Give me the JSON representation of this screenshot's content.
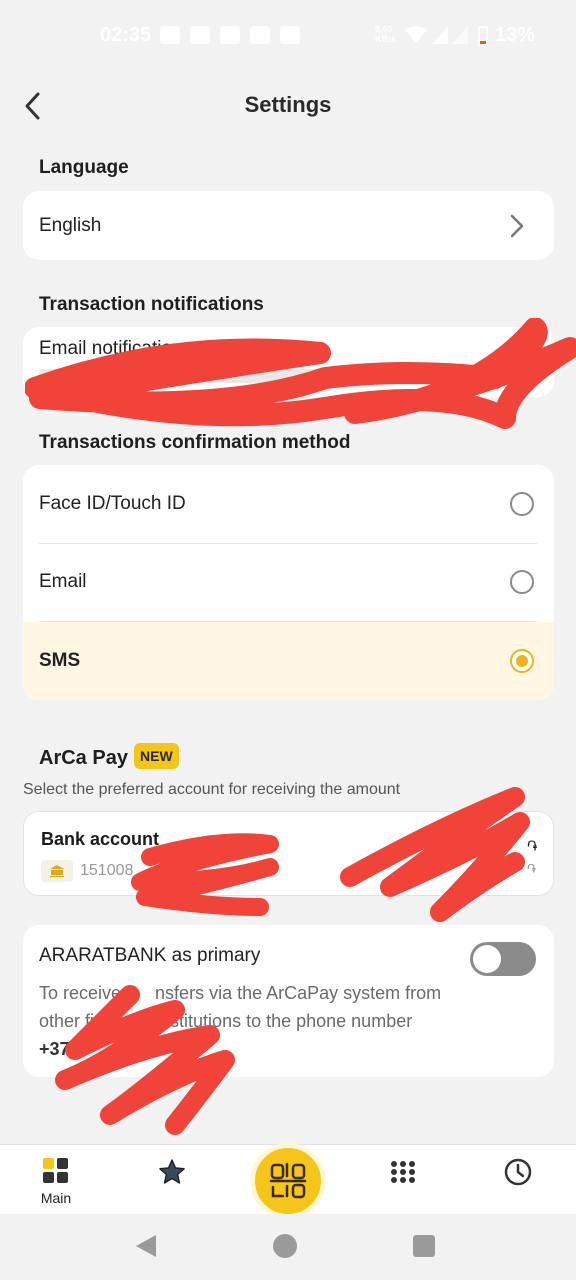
{
  "status_bar": {
    "time": "02:35",
    "battery": "13%",
    "speed": "0.60 KB/s"
  },
  "header": {
    "title": "Settings"
  },
  "language": {
    "section_title": "Language",
    "value": "English"
  },
  "transaction_notifications": {
    "section_title": "Transaction notifications",
    "email_label": "Email notifications"
  },
  "confirmation_method": {
    "section_title": "Transactions confirmation method",
    "options": [
      {
        "label": "Face ID/Touch ID",
        "selected": false
      },
      {
        "label": "Email",
        "selected": false
      },
      {
        "label": "SMS",
        "selected": true
      }
    ]
  },
  "arcapay": {
    "title": "ArCa Pay",
    "badge": "NEW",
    "subtitle": "Select the preferred account for receiving the amount",
    "bank_account_title": "Bank account",
    "bank_account_number_partial": "151008",
    "currency_symbol": "֏"
  },
  "primary": {
    "title": "ARARATBANK as primary",
    "desc_line1": "To receive tr",
    "desc_line1b": "nsfers via the ArCaPay system from",
    "desc_line2a": "other fi",
    "desc_line2b": "cial i",
    "desc_line2c": "stitutions to the phone number",
    "phone_partial": "+374",
    "toggle_on": false
  },
  "bottom_nav": {
    "items": [
      {
        "label": "Main",
        "icon": "grid-icon"
      },
      {
        "label": "",
        "icon": "star-icon"
      },
      {
        "label": "",
        "icon": "qr-icon"
      },
      {
        "label": "",
        "icon": "dots-grid-icon"
      },
      {
        "label": "",
        "icon": "history-clock-icon"
      }
    ]
  },
  "colors": {
    "accent": "#f5c519",
    "selected_row_bg": "#fff6e3",
    "redaction": "#f0433a"
  }
}
